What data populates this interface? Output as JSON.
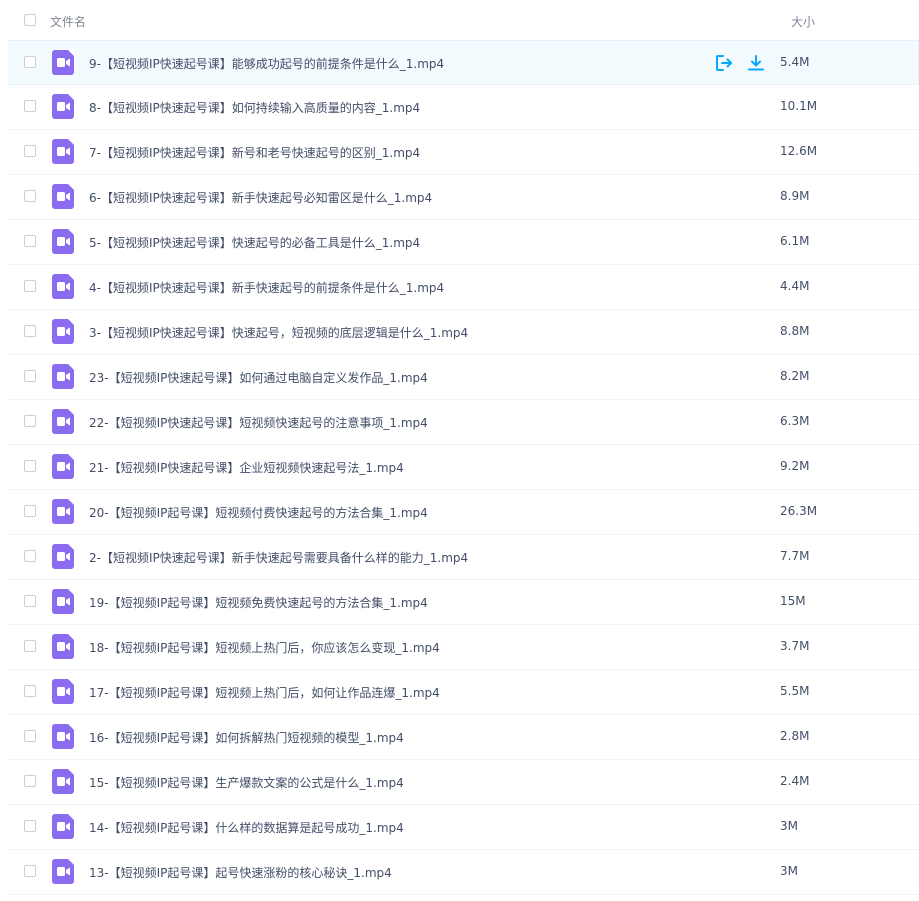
{
  "header": {
    "name_label": "文件名",
    "size_label": "大小"
  },
  "colors": {
    "accent": "#06a7ff",
    "video_icon": "#8b6cf0"
  },
  "files": [
    {
      "name": "9-【短视频IP快速起号课】能够成功起号的前提条件是什么_1.mp4",
      "size": "5.4M",
      "hovered": true
    },
    {
      "name": "8-【短视频IP快速起号课】如何持续输入高质量的内容_1.mp4",
      "size": "10.1M"
    },
    {
      "name": "7-【短视频IP快速起号课】新号和老号快速起号的区别_1.mp4",
      "size": "12.6M"
    },
    {
      "name": "6-【短视频IP快速起号课】新手快速起号必知雷区是什么_1.mp4",
      "size": "8.9M"
    },
    {
      "name": "5-【短视频IP快速起号课】快速起号的必备工具是什么_1.mp4",
      "size": "6.1M"
    },
    {
      "name": "4-【短视频IP快速起号课】新手快速起号的前提条件是什么_1.mp4",
      "size": "4.4M"
    },
    {
      "name": "3-【短视频IP快速起号课】快速起号，短视频的底层逻辑是什么_1.mp4",
      "size": "8.8M"
    },
    {
      "name": "23-【短视频IP快速起号课】如何通过电脑自定义发作品_1.mp4",
      "size": "8.2M"
    },
    {
      "name": "22-【短视频IP快速起号课】短视频快速起号的注意事项_1.mp4",
      "size": "6.3M"
    },
    {
      "name": "21-【短视频IP快速起号课】企业短视频快速起号法_1.mp4",
      "size": "9.2M"
    },
    {
      "name": "20-【短视频IP起号课】短视频付费快速起号的方法合集_1.mp4",
      "size": "26.3M"
    },
    {
      "name": "2-【短视频IP快速起号课】新手快速起号需要具备什么样的能力_1.mp4",
      "size": "7.7M"
    },
    {
      "name": "19-【短视频IP起号课】短视频免费快速起号的方法合集_1.mp4",
      "size": "15M"
    },
    {
      "name": "18-【短视频IP起号课】短视频上热门后，你应该怎么变现_1.mp4",
      "size": "3.7M"
    },
    {
      "name": "17-【短视频IP起号课】短视频上热门后，如何让作品连爆_1.mp4",
      "size": "5.5M"
    },
    {
      "name": "16-【短视频IP起号课】如何拆解热门短视频的模型_1.mp4",
      "size": "2.8M"
    },
    {
      "name": "15-【短视频IP起号课】生产爆款文案的公式是什么_1.mp4",
      "size": "2.4M"
    },
    {
      "name": "14-【短视频IP起号课】什么样的数据算是起号成功_1.mp4",
      "size": "3M"
    },
    {
      "name": "13-【短视频IP起号课】起号快速涨粉的核心秘诀_1.mp4",
      "size": "3M"
    }
  ]
}
